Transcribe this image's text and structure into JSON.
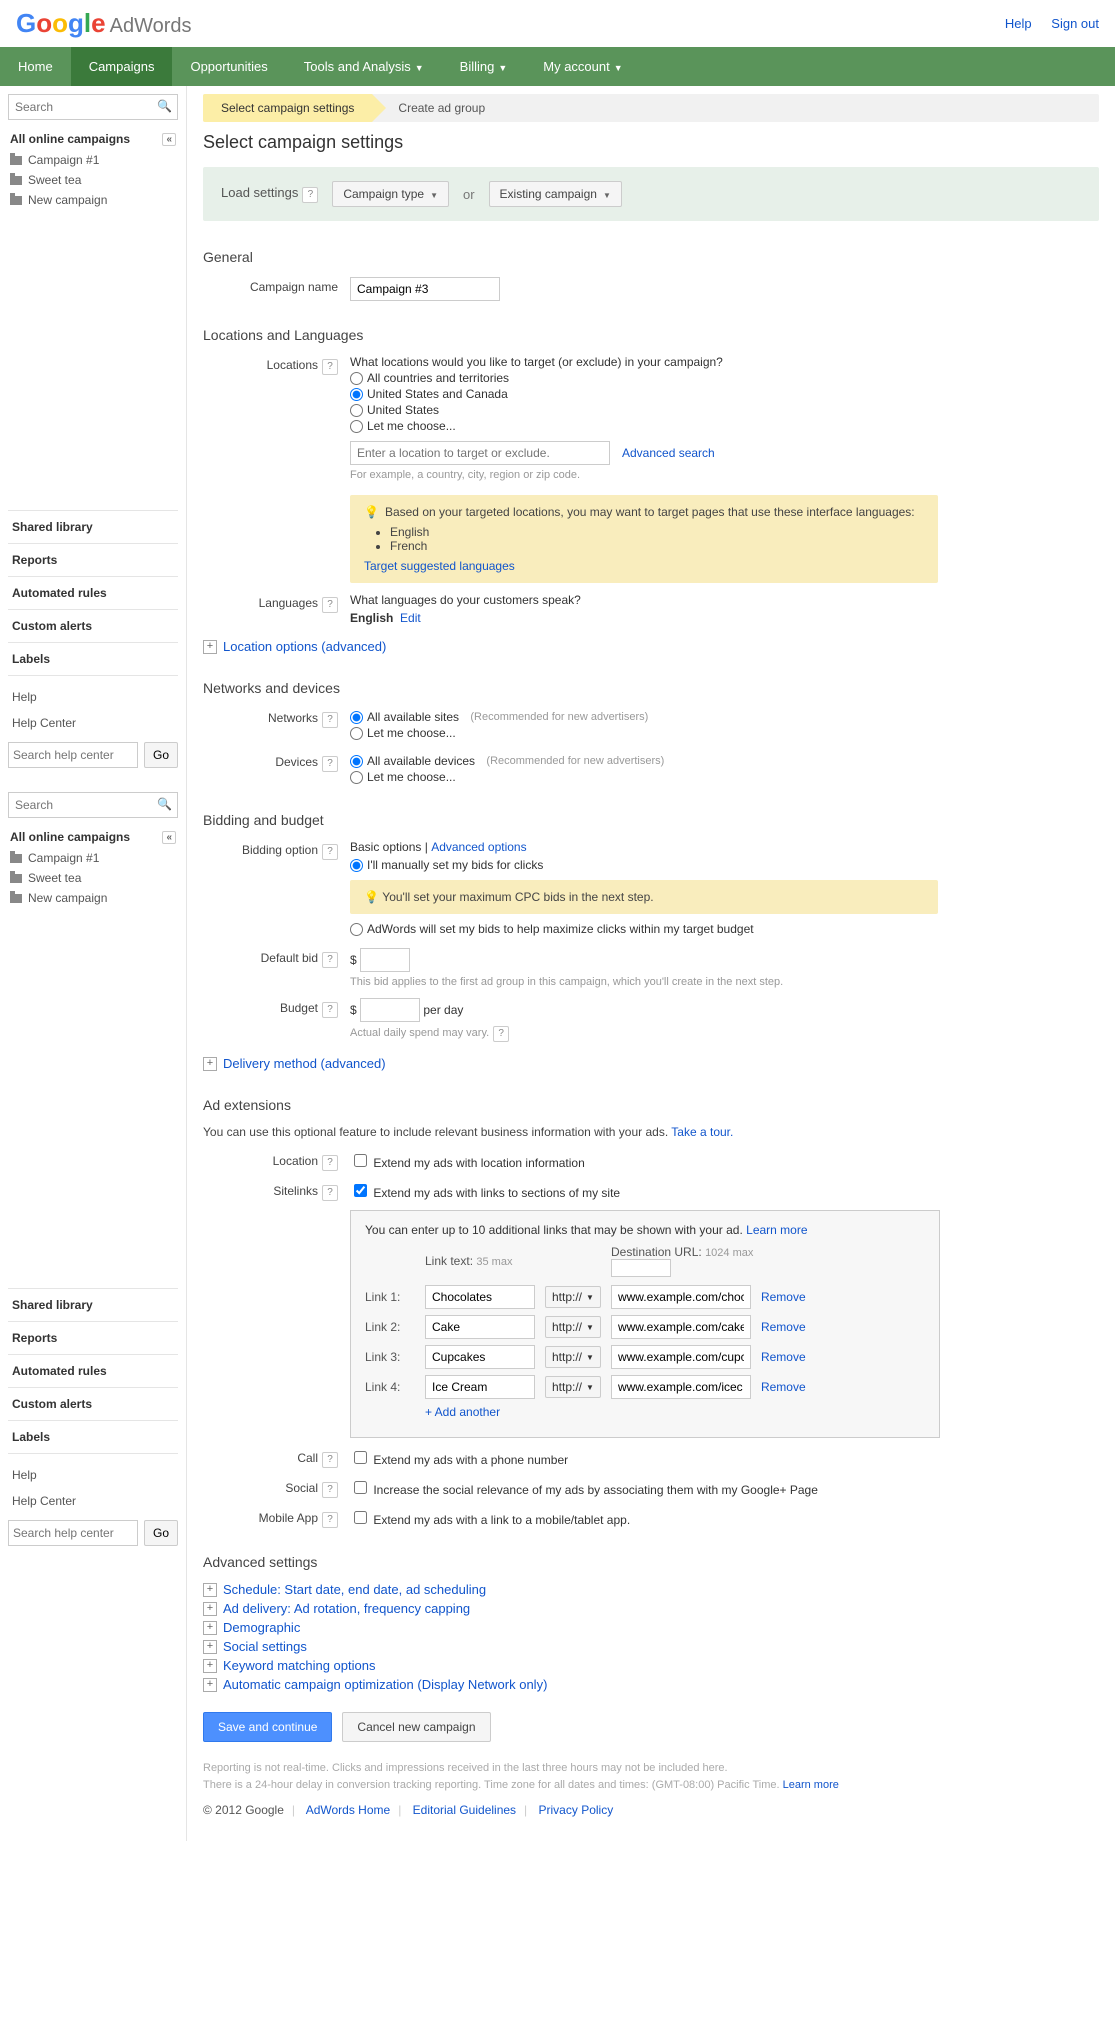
{
  "top": {
    "help": "Help",
    "signout": "Sign out",
    "product": "AdWords"
  },
  "nav": [
    "Home",
    "Campaigns",
    "Opportunities",
    "Tools and Analysis",
    "Billing",
    "My account"
  ],
  "search_ph": "Search",
  "tree": {
    "header": "All online campaigns",
    "items": [
      "Campaign #1",
      "Sweet tea",
      "New campaign"
    ]
  },
  "side_list": [
    "Shared library",
    "Reports",
    "Automated rules",
    "Custom alerts",
    "Labels"
  ],
  "side_plain": [
    "Help",
    "Help Center"
  ],
  "hc_ph": "Search help center",
  "go": "Go",
  "crumbs": [
    "Select campaign settings",
    "Create ad group"
  ],
  "page_title": "Select campaign settings",
  "load": {
    "label": "Load settings",
    "type": "Campaign type",
    "or": "or",
    "existing": "Existing campaign"
  },
  "general": {
    "h": "General",
    "name_label": "Campaign name",
    "name_value": "Campaign #3"
  },
  "locations": {
    "h": "Locations and Languages",
    "label": "Locations",
    "question": "What locations would you like to target (or exclude) in your campaign?",
    "opts": [
      "All countries and territories",
      "United States and Canada",
      "United States",
      "Let me choose..."
    ],
    "input_ph": "Enter a location to target or exclude.",
    "adv": "Advanced search",
    "example": "For example, a country, city, region or zip code.",
    "tip": "Based on your targeted locations, you may want to target pages that use these interface languages:",
    "tip_items": [
      "English",
      "French"
    ],
    "tip_link": "Target suggested languages"
  },
  "languages": {
    "label": "Languages",
    "q": "What languages do your customers speak?",
    "val": "English",
    "edit": "Edit"
  },
  "loc_adv": "Location options (advanced)",
  "networks": {
    "h": "Networks and devices",
    "net_label": "Networks",
    "dev_label": "Devices",
    "net_all": "All available sites",
    "dev_all": "All available devices",
    "rec": "(Recommended for new advertisers)",
    "choose": "Let me choose..."
  },
  "bidding": {
    "h": "Bidding and budget",
    "opt_label": "Bidding option",
    "basic": "Basic options",
    "adv": "Advanced options",
    "sep": "|",
    "manual": "I'll manually set my bids for clicks",
    "note": "You'll set your maximum CPC bids in the next step.",
    "auto": "AdWords will set my bids to help maximize clicks within my target budget",
    "default_label": "Default bid",
    "currency": "$",
    "default_hint": "This bid applies to the first ad group in this campaign, which you'll create in the next step.",
    "budget_label": "Budget",
    "per_day": "per day",
    "budget_hint": "Actual daily spend may vary.",
    "delivery": "Delivery method (advanced)"
  },
  "ext": {
    "h": "Ad extensions",
    "intro": "You can use this optional feature to include relevant business information with your ads.",
    "tour": "Take a tour.",
    "location": {
      "label": "Location",
      "text": "Extend my ads with location information"
    },
    "sitelinks": {
      "label": "Sitelinks",
      "text": "Extend my ads with links to sections of my site",
      "box": {
        "intro": "You can enter up to 10 additional links that may be shown with your ad.",
        "learn": "Learn more",
        "link_text_h": "Link text:",
        "link_text_max": "35 max",
        "dest_h": "Destination URL:",
        "dest_max": "1024 max",
        "rows": [
          {
            "label": "Link 1:",
            "text": "Chocolates",
            "proto": "http://",
            "url": "www.example.com/choc"
          },
          {
            "label": "Link 2:",
            "text": "Cake",
            "proto": "http://",
            "url": "www.example.com/cake"
          },
          {
            "label": "Link 3:",
            "text": "Cupcakes",
            "proto": "http://",
            "url": "www.example.com/cupc"
          },
          {
            "label": "Link 4:",
            "text": "Ice Cream",
            "proto": "http://",
            "url": "www.example.com/icec"
          }
        ],
        "remove": "Remove",
        "add": "+ Add another"
      }
    },
    "call": {
      "label": "Call",
      "text": "Extend my ads with a phone number"
    },
    "social": {
      "label": "Social",
      "text": "Increase the social relevance of my ads by associating them with my Google+ Page"
    },
    "mobile": {
      "label": "Mobile App",
      "text": "Extend my ads with a link to a mobile/tablet app."
    }
  },
  "advanced": {
    "h": "Advanced settings",
    "items": [
      "Schedule: Start date, end date, ad scheduling",
      "Ad delivery: Ad rotation, frequency capping",
      "Demographic",
      "Social settings",
      "Keyword matching options",
      "Automatic campaign optimization (Display Network only)"
    ]
  },
  "buttons": {
    "save": "Save and continue",
    "cancel": "Cancel new campaign"
  },
  "footer": {
    "note1": "Reporting is not real-time. Clicks and impressions received in the last three hours may not be included here.",
    "note2": "There is a 24-hour delay in conversion tracking reporting. Time zone for all dates and times: (GMT-08:00) Pacific Time.",
    "learn": "Learn more",
    "copyright": "© 2012 Google",
    "links": [
      "AdWords Home",
      "Editorial Guidelines",
      "Privacy Policy"
    ]
  }
}
